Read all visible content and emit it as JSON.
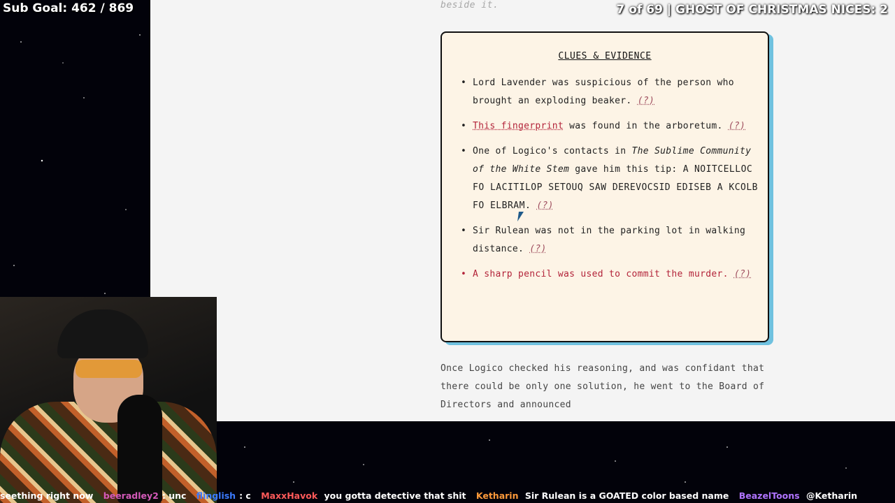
{
  "overlay": {
    "sub_goal": "Sub Goal: 462 / 869",
    "episode": "7 of 69 | GHOST OF CHRISTMAS NICES: 2"
  },
  "page": {
    "top_text": "beside it.",
    "clues_title": "CLUES & EVIDENCE",
    "clues": [
      {
        "text": "Lord Lavender was suspicious of the person who brought an exploding beaker.",
        "q": "(?)"
      },
      {
        "link": "This fingerprint",
        "text": " was found in the arboretum.",
        "q": "(?)"
      },
      {
        "pre": "One of Logico's contacts in ",
        "em": "The Sublime Community of the White Stem",
        "post": " gave him this tip: A ",
        "cipher": "NOITCELLOC FO LACITILOP SETOUQ SAW DEREVOCSID EDISEB A KCOLB FO ELBRAM.",
        "q": "(?)"
      },
      {
        "text": "Sir Rulean was not in the parking lot in walking distance.",
        "q": "(?)"
      },
      {
        "text": "A sharp pencil was used to commit the murder.",
        "q": "(?)"
      }
    ],
    "after_text": "Once Logico checked his reasoning, and was confidant that there could be only one solution, he went to the Board of Directors and announced"
  },
  "chat": [
    {
      "user": "",
      "msg": "seething right now"
    },
    {
      "user": "beeradley2",
      "msg": ": unc"
    },
    {
      "user": "flinglish",
      "msg": ": c"
    },
    {
      "user": "MaxxHavok",
      "msg": " you gotta detective that shit"
    },
    {
      "user": "Ketharin",
      "msg": " Sir Rulean is a GOATED color based name"
    },
    {
      "user": "BeazelToons",
      "msg": " @Ketharin"
    }
  ],
  "colors": {
    "accent_red": "#b3243a",
    "box_shadow": "#6fc1df",
    "box_bg": "#fdf4e6"
  }
}
